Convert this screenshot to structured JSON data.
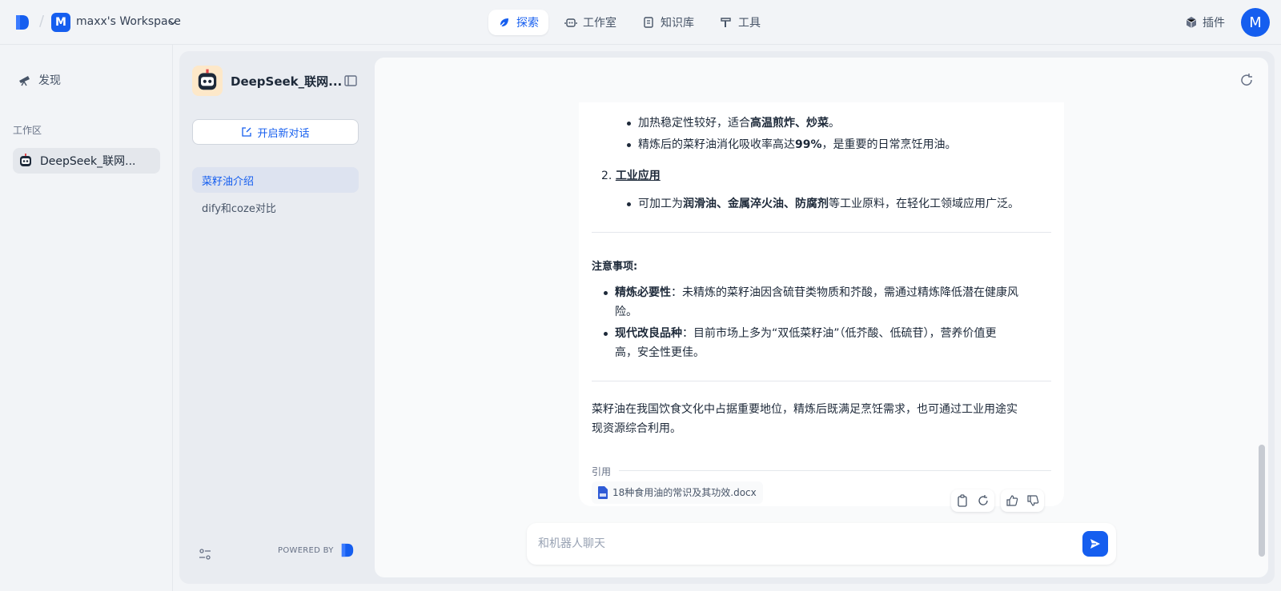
{
  "header": {
    "workspace_initial": "M",
    "workspace_name": "maxx's Workspace",
    "nav": [
      {
        "label": "探索",
        "icon": "compass-icon",
        "active": true
      },
      {
        "label": "工作室",
        "icon": "robot-icon",
        "active": false
      },
      {
        "label": "知识库",
        "icon": "book-icon",
        "active": false
      },
      {
        "label": "工具",
        "icon": "hammer-icon",
        "active": false
      }
    ],
    "plugin_label": "插件",
    "user_initial": "M",
    "accent_color": "#155eef"
  },
  "leftbar": {
    "discover_label": "发现",
    "section_label": "工作区",
    "app_name": "DeepSeek_联网..."
  },
  "conversations": {
    "app_title": "DeepSeek_联网...",
    "new_chat_label": "开启新对话",
    "items": [
      {
        "label": "菜籽油介绍",
        "active": true
      },
      {
        "label": "dify和coze对比",
        "active": false
      }
    ],
    "powered_by": "POWERED BY"
  },
  "chat": {
    "message": {
      "line1_prefix": "加热稳定性较好，适合",
      "line1_bold": "高温煎炸、炒菜",
      "line1_suffix": "。",
      "line2_prefix": "精炼后的菜籽油消化吸收率高达",
      "line2_bold": "99%",
      "line2_suffix": "，是重要的日常烹饪用油。",
      "list2_number": "2.",
      "list2_title": "工业应用",
      "line3_prefix": "可加工为",
      "line3_bold": "润滑油、金属淬火油、防腐剂",
      "line3_suffix": "等工业原料，在轻化工领域应用广泛。",
      "notes_title": "注意事项:",
      "note1_bold": "精炼必要性",
      "note1_text_a": "：未精炼的菜籽油因含硫苷类物质和芥酸，需通过精炼降低潜在健康风",
      "note1_text_b": "险。",
      "note2_bold": "现代改良品种",
      "note2_text_a": "：目前市场上多为“双低菜籽油”（低芥酸、低硫苷），营养价值更",
      "note2_text_b": "高，安全性更佳。",
      "summary_a": "菜籽油在我国饮食文化中占据重要地位，精炼后既满足烹饪需求，也可通过工业用途实",
      "summary_b": "现资源综合利用。"
    },
    "citation_label": "引用",
    "citation_file": "18种食用油的常识及其功效.docx",
    "input_placeholder": "和机器人聊天"
  }
}
